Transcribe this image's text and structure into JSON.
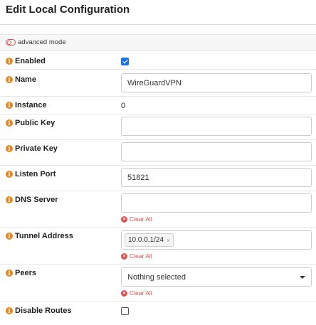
{
  "dialog": {
    "title": "Edit Local Configuration"
  },
  "advanced_mode": {
    "label": "advanced mode"
  },
  "fields": {
    "enabled": {
      "label": "Enabled",
      "checked": true
    },
    "name": {
      "label": "Name",
      "value": "WireGuardVPN"
    },
    "instance": {
      "label": "Instance",
      "value": "0"
    },
    "public_key": {
      "label": "Public Key",
      "value": ""
    },
    "private_key": {
      "label": "Private Key",
      "value": ""
    },
    "listen_port": {
      "label": "Listen Port",
      "value": "51821"
    },
    "dns_server": {
      "label": "DNS Server",
      "value": "",
      "clear_label": "Clear All"
    },
    "tunnel_address": {
      "label": "Tunnel Address",
      "tags": [
        "10.0.0.1/24"
      ],
      "clear_label": "Clear All"
    },
    "peers": {
      "label": "Peers",
      "selected": "Nothing selected",
      "clear_label": "Clear All"
    },
    "disable_routes": {
      "label": "Disable Routes",
      "checked": false
    }
  },
  "colors": {
    "info_icon": "#e8861a",
    "clear_red": "#d9534f",
    "checkbox_blue": "#1a73e8"
  },
  "icons": {
    "info": "info-circle",
    "clear": "times-circle",
    "advanced": "toggle-off",
    "caret": "caret-down"
  }
}
